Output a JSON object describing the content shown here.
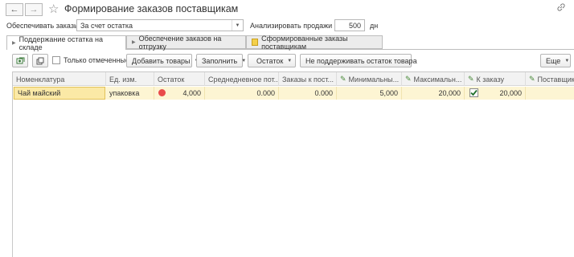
{
  "window": {
    "title": "Формирование заказов поставщикам"
  },
  "nav": {
    "back": "←",
    "forward": "→",
    "star": "☆",
    "link": "🔗"
  },
  "filters": {
    "supply_label": "Обеспечивать заказы:",
    "supply_value": "За счет остатка",
    "analyze_label": "Анализировать продажи за:",
    "analyze_value": "500",
    "analyze_unit": "дн"
  },
  "tabs": [
    {
      "label": "Поддержание остатка на складе"
    },
    {
      "label": "Обеспечение заказов на отгрузку"
    },
    {
      "label": "Сформированные заказы поставщикам"
    }
  ],
  "toolbar": {
    "only_marked": "Только отмеченные",
    "add_goods": "Добавить товары",
    "fill": "Заполнить",
    "remainder": "Остаток",
    "not_maintain": "Не поддерживать остаток товара",
    "more": "Еще"
  },
  "table": {
    "headers": [
      "Номенклатура",
      "Ед. изм.",
      "Остаток",
      "Среднедневное пот...",
      "Заказы к пост...",
      "Минимальны...",
      "Максимальн...",
      "К заказу",
      "Поставщик"
    ],
    "rows": [
      {
        "name": "Чай майский",
        "unit": "упаковка",
        "stock": "4,000",
        "avg": "0.000",
        "orders": "0.000",
        "min": "5,000",
        "max": "20,000",
        "to_order": "20,000",
        "supplier": ""
      }
    ]
  }
}
